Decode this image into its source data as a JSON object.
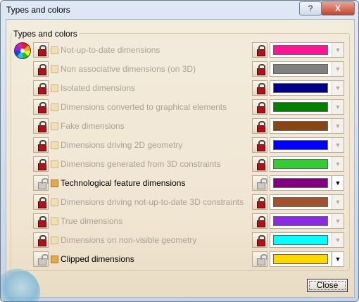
{
  "window": {
    "title": "Types and colors",
    "help_glyph": "?",
    "close_glyph": "X"
  },
  "frame": {
    "title": "Types and colors"
  },
  "rows": [
    {
      "label": "Not-up-to-date dimensions",
      "color": "#ff1493",
      "enabled": false,
      "locked": true
    },
    {
      "label": "Non associative dimensions (on 3D)",
      "color": "#808080",
      "enabled": false,
      "locked": true
    },
    {
      "label": "Isolated dimensions",
      "color": "#00008b",
      "enabled": false,
      "locked": true
    },
    {
      "label": "Dimensions converted to graphical elements",
      "color": "#008000",
      "enabled": false,
      "locked": true
    },
    {
      "label": "Fake dimensions",
      "color": "#8b4513",
      "enabled": false,
      "locked": true
    },
    {
      "label": "Dimensions driving 2D geometry",
      "color": "#0000ff",
      "enabled": false,
      "locked": true
    },
    {
      "label": "Dimensions generated from 3D constraints",
      "color": "#32cd32",
      "enabled": false,
      "locked": true
    },
    {
      "label": "Technological feature dimensions",
      "color": "#800080",
      "enabled": true,
      "locked": false
    },
    {
      "label": "Dimensions driving not-up-to-date 3D constraints",
      "color": "#a0522d",
      "enabled": false,
      "locked": true
    },
    {
      "label": "True dimensions",
      "color": "#8a2be2",
      "enabled": false,
      "locked": true
    },
    {
      "label": "Dimensions on non-visible geometry",
      "color": "#00ffff",
      "enabled": false,
      "locked": true
    },
    {
      "label": "Clipped dimensions",
      "color": "#ffd700",
      "enabled": true,
      "locked": false
    }
  ],
  "buttons": {
    "close": "Close"
  }
}
